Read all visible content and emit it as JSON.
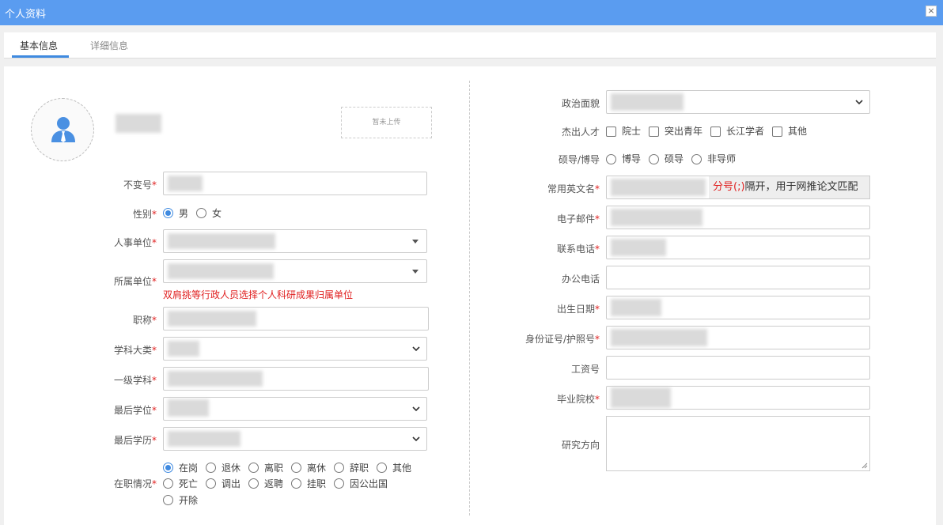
{
  "window": {
    "title": "个人资料",
    "close_glyph": "×"
  },
  "tabs": [
    {
      "label": "基本信息",
      "active": true
    },
    {
      "label": "详细信息",
      "active": false
    }
  ],
  "upload": {
    "label": "暂未上传"
  },
  "left_form": {
    "id_label": "不变号",
    "gender_label": "性别",
    "gender_options": [
      "男",
      "女"
    ],
    "gender_selected": "男",
    "hr_unit_label": "人事单位",
    "dept_unit_label": "所属单位",
    "dept_hint": "双肩挑等行政人员选择个人科研成果归属单位",
    "title_label": "职称",
    "discipline_label": "学科大类",
    "first_discipline_label": "一级学科",
    "degree_label": "最后学位",
    "education_label": "最后学历",
    "employment_label": "在职情况",
    "employment_options": [
      "在岗",
      "退休",
      "离职",
      "离休",
      "辞职",
      "其他",
      "死亡",
      "调出",
      "返聘",
      "挂职",
      "因公出国",
      "开除"
    ],
    "employment_selected": "在岗"
  },
  "right_form": {
    "political_label": "政治面貌",
    "talent_label": "杰出人才",
    "talent_options": [
      "院士",
      "突出青年",
      "长江学者",
      "其他"
    ],
    "supervisor_label": "硕导/博导",
    "supervisor_options": [
      "博导",
      "硕导",
      "非导师"
    ],
    "english_name_label": "常用英文名",
    "english_name_hint_red": "分号(;)",
    "english_name_hint": "隔开，用于网推论文匹配",
    "email_label": "电子邮件",
    "phone_label": "联系电话",
    "office_phone_label": "办公电话",
    "birth_label": "出生日期",
    "id_card_label": "身份证号/护照号",
    "salary_label": "工资号",
    "school_label": "毕业院校",
    "research_label": "研究方向"
  },
  "required_mark": "*",
  "colors": {
    "titlebar": "#5a9cf0",
    "accent": "#3f8ae0",
    "required": "#e02020"
  }
}
